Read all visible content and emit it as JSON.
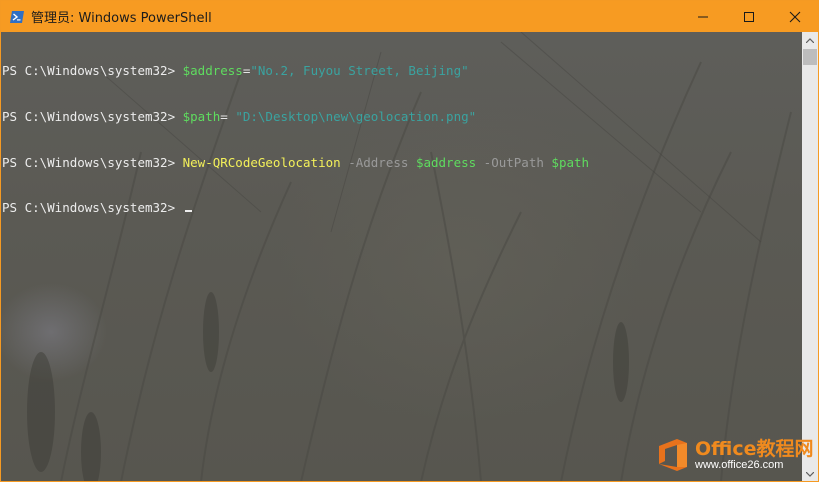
{
  "window": {
    "title": "管理员: Windows PowerShell",
    "app_icon": "powershell-icon",
    "controls": {
      "minimize_icon": "minimize-icon",
      "maximize_icon": "maximize-icon",
      "close_icon": "close-icon"
    },
    "titlebar_color": "#f79b22"
  },
  "console": {
    "lines": [
      {
        "prompt": "PS C:\\Windows\\system32> ",
        "tokens": [
          {
            "text": "$address",
            "kind": "var"
          },
          {
            "text": "=",
            "kind": "plain"
          },
          {
            "text": "\"No.2, Fuyou Street, Beijing\"",
            "kind": "str"
          }
        ]
      },
      {
        "prompt": "PS C:\\Windows\\system32> ",
        "tokens": [
          {
            "text": "$path",
            "kind": "var"
          },
          {
            "text": "= ",
            "kind": "plain"
          },
          {
            "text": "\"D:\\Desktop\\new\\geolocation.png\"",
            "kind": "str"
          }
        ]
      },
      {
        "prompt": "PS C:\\Windows\\system32> ",
        "tokens": [
          {
            "text": "New-QRCodeGeolocation",
            "kind": "cmd"
          },
          {
            "text": " -Address ",
            "kind": "param"
          },
          {
            "text": "$address",
            "kind": "var"
          },
          {
            "text": " -OutPath ",
            "kind": "param"
          },
          {
            "text": "$path",
            "kind": "var"
          }
        ]
      },
      {
        "prompt": "PS C:\\Windows\\system32> ",
        "tokens": [],
        "cursor": true
      }
    ],
    "colors": {
      "var": "#5fdc5f",
      "str": "#3aa3a0",
      "cmd": "#f3f05a",
      "param": "#9a9a9a",
      "prompt": "#ececec"
    }
  },
  "scrollbar": {
    "up_icon": "scroll-up-icon",
    "down_icon": "scroll-down-icon"
  },
  "watermark": {
    "brand": "Office教程网",
    "url": "www.office26.com",
    "logo_icon": "office-logo-icon"
  }
}
